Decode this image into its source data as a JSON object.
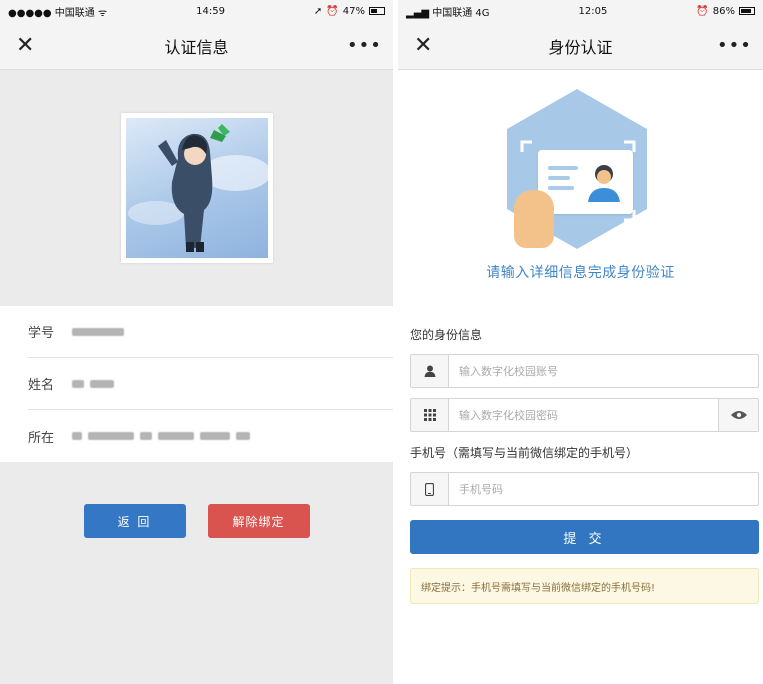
{
  "left": {
    "status": {
      "carrier": "●●●●● 中国联通 ᯤ",
      "time": "14:59",
      "battery": "47%",
      "battery_level": 0.47
    },
    "nav": {
      "close": "✕",
      "title": "认证信息",
      "more": "•••"
    },
    "rows": [
      {
        "label": "学号"
      },
      {
        "label": "姓名"
      },
      {
        "label": "所在"
      }
    ],
    "buttons": {
      "back": "返 回",
      "unbind": "解除绑定"
    },
    "colors": {
      "back_button": "#3477c4",
      "unbind_button": "#d9534f"
    }
  },
  "right": {
    "status": {
      "carrier": "▂▄▆ 中国联通 4G",
      "time": "12:05",
      "battery": "86%",
      "battery_level": 0.86
    },
    "nav": {
      "close": "✕",
      "title": "身份认证",
      "more": "•••"
    },
    "verify_text": "请输入详细信息完成身份验证",
    "identity_section": "您的身份信息",
    "account_placeholder": "输入数字化校园账号",
    "password_placeholder": "输入数字化校园密码",
    "phone_section": "手机号（需填写与当前微信绑定的手机号）",
    "phone_placeholder": "手机号码",
    "submit": "提 交",
    "tip": "绑定提示：手机号需填写与当前微信绑定的手机号码!",
    "icons": {
      "account": "user-icon",
      "password": "keypad-icon",
      "toggle": "eye-icon",
      "phone": "phone-icon"
    },
    "colors": {
      "accent": "#3f86c8",
      "submit_button": "#3275c0",
      "tip_background": "#fcf8e3"
    }
  }
}
